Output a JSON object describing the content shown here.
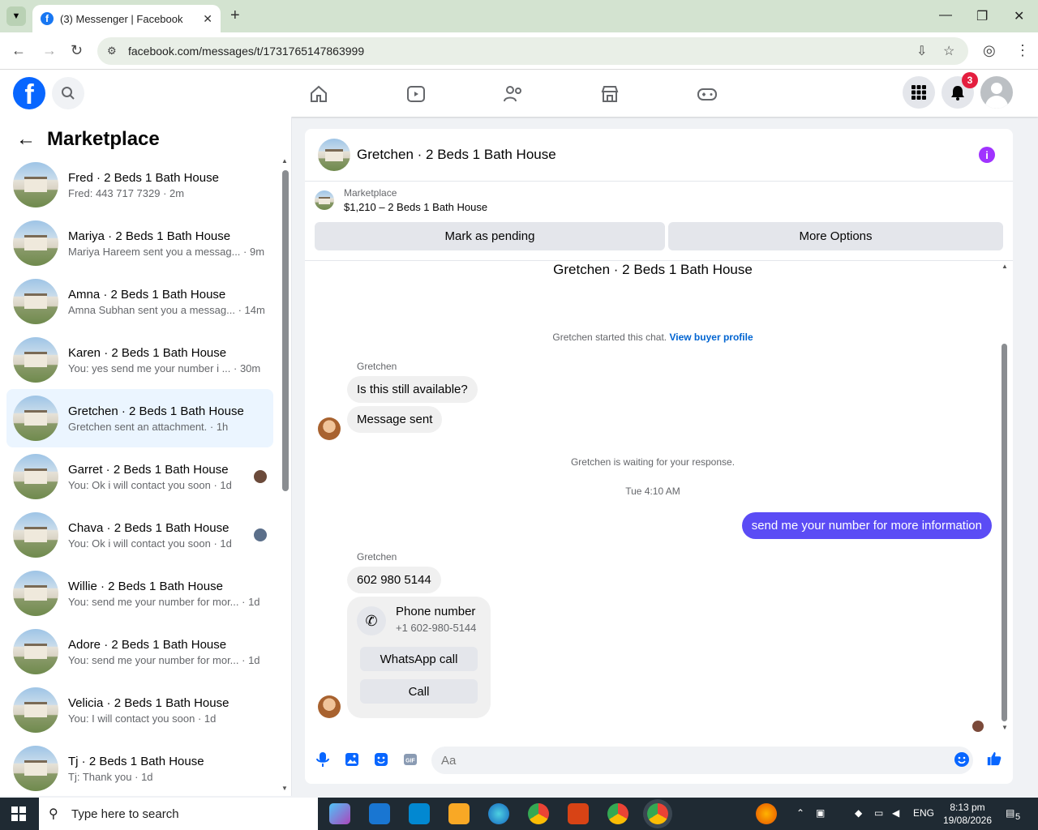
{
  "browser": {
    "tab_title": "(3) Messenger | Facebook",
    "url": "facebook.com/messages/t/1731765147863999"
  },
  "fb": {
    "notif_count": "3",
    "logo": "f"
  },
  "sidebar": {
    "title": "Marketplace",
    "conversations": [
      {
        "name": "Fred · 2 Beds 1 Bath House",
        "preview": "Fred: 443 717 7329 · 2m"
      },
      {
        "name": "Mariya · 2 Beds 1 Bath House",
        "preview": "Mariya Hareem sent you a messag... · 9m"
      },
      {
        "name": "Amna · 2 Beds 1 Bath House",
        "preview": "Amna Subhan sent you a messag... · 14m"
      },
      {
        "name": "Karen · 2 Beds 1 Bath House",
        "preview": "You: yes send me your number i ... · 30m"
      },
      {
        "name": "Gretchen · 2 Beds 1 Bath House",
        "preview": "Gretchen sent an attachment. · 1h"
      },
      {
        "name": "Garret · 2 Beds 1 Bath House",
        "preview": "You: Ok i will contact you soon · 1d"
      },
      {
        "name": "Chava · 2 Beds 1 Bath House",
        "preview": "You: Ok i will contact you soon · 1d"
      },
      {
        "name": "Willie · 2 Beds 1 Bath House",
        "preview": "You: send me your number for mor... · 1d"
      },
      {
        "name": "Adore · 2 Beds 1 Bath House",
        "preview": "You: send me your number for mor... · 1d"
      },
      {
        "name": "Velicia · 2 Beds 1 Bath House",
        "preview": "You: I will contact you soon · 1d"
      },
      {
        "name": "Tj · 2 Beds 1 Bath House",
        "preview": "Tj: Thank you · 1d"
      }
    ]
  },
  "chat": {
    "title": "Gretchen · 2 Beds 1 Bath House",
    "market_label": "Marketplace",
    "listing": "$1,210 – 2 Beds 1 Bath House",
    "btn_pending": "Mark as pending",
    "btn_more": "More Options",
    "conv_title": "Gretchen · 2 Beds 1 Bath House",
    "started": "Gretchen started this chat.",
    "view_profile": "View buyer profile",
    "sender1": "Gretchen",
    "msg1": "Is this still available?",
    "msg2": "Message sent",
    "waiting": "Gretchen is waiting for your response.",
    "timestamp": "Tue 4:10 AM",
    "out1": "send me your number for more information",
    "sender2": "Gretchen",
    "msg3": "602 980 5144",
    "card_title": "Phone number",
    "card_value": "+1 602-980-5144",
    "card_btn1": "WhatsApp call",
    "card_btn2": "Call",
    "composer_placeholder": "Aa"
  },
  "taskbar": {
    "search_placeholder": "Type here to search",
    "lang": "ENG",
    "time": "8:13 pm",
    "date": "19/08/2026",
    "notif": "5"
  },
  "colors": {
    "fb_blue": "#0866ff",
    "outgoing_bubble": "#5b4cf5",
    "info_purple": "#a033ff",
    "active_row": "#ebf5ff"
  }
}
